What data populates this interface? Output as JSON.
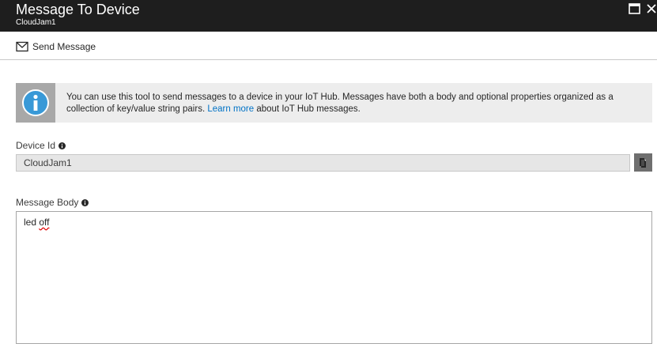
{
  "header": {
    "title": "Message To Device",
    "subtitle": "CloudJam1"
  },
  "toolbar": {
    "send_label": "Send Message"
  },
  "info": {
    "text_before": "You can use this tool to send messages to a device in your IoT Hub. Messages have both a body and optional properties organized as a collection of key/value string pairs. ",
    "link": "Learn more",
    "text_after": " about IoT Hub messages."
  },
  "device_id": {
    "label": "Device Id",
    "value": "CloudJam1"
  },
  "message_body": {
    "label": "Message Body",
    "word1": "led",
    "word2": "off"
  },
  "colors": {
    "header_bg": "#1e1e1e",
    "link": "#0072c6",
    "info_icon": "#3999d7",
    "info_bg": "#ededed"
  },
  "icons": {
    "send": "envelope-icon",
    "info": "info-icon",
    "copy": "copy-icon",
    "maximize": "maximize-icon"
  }
}
